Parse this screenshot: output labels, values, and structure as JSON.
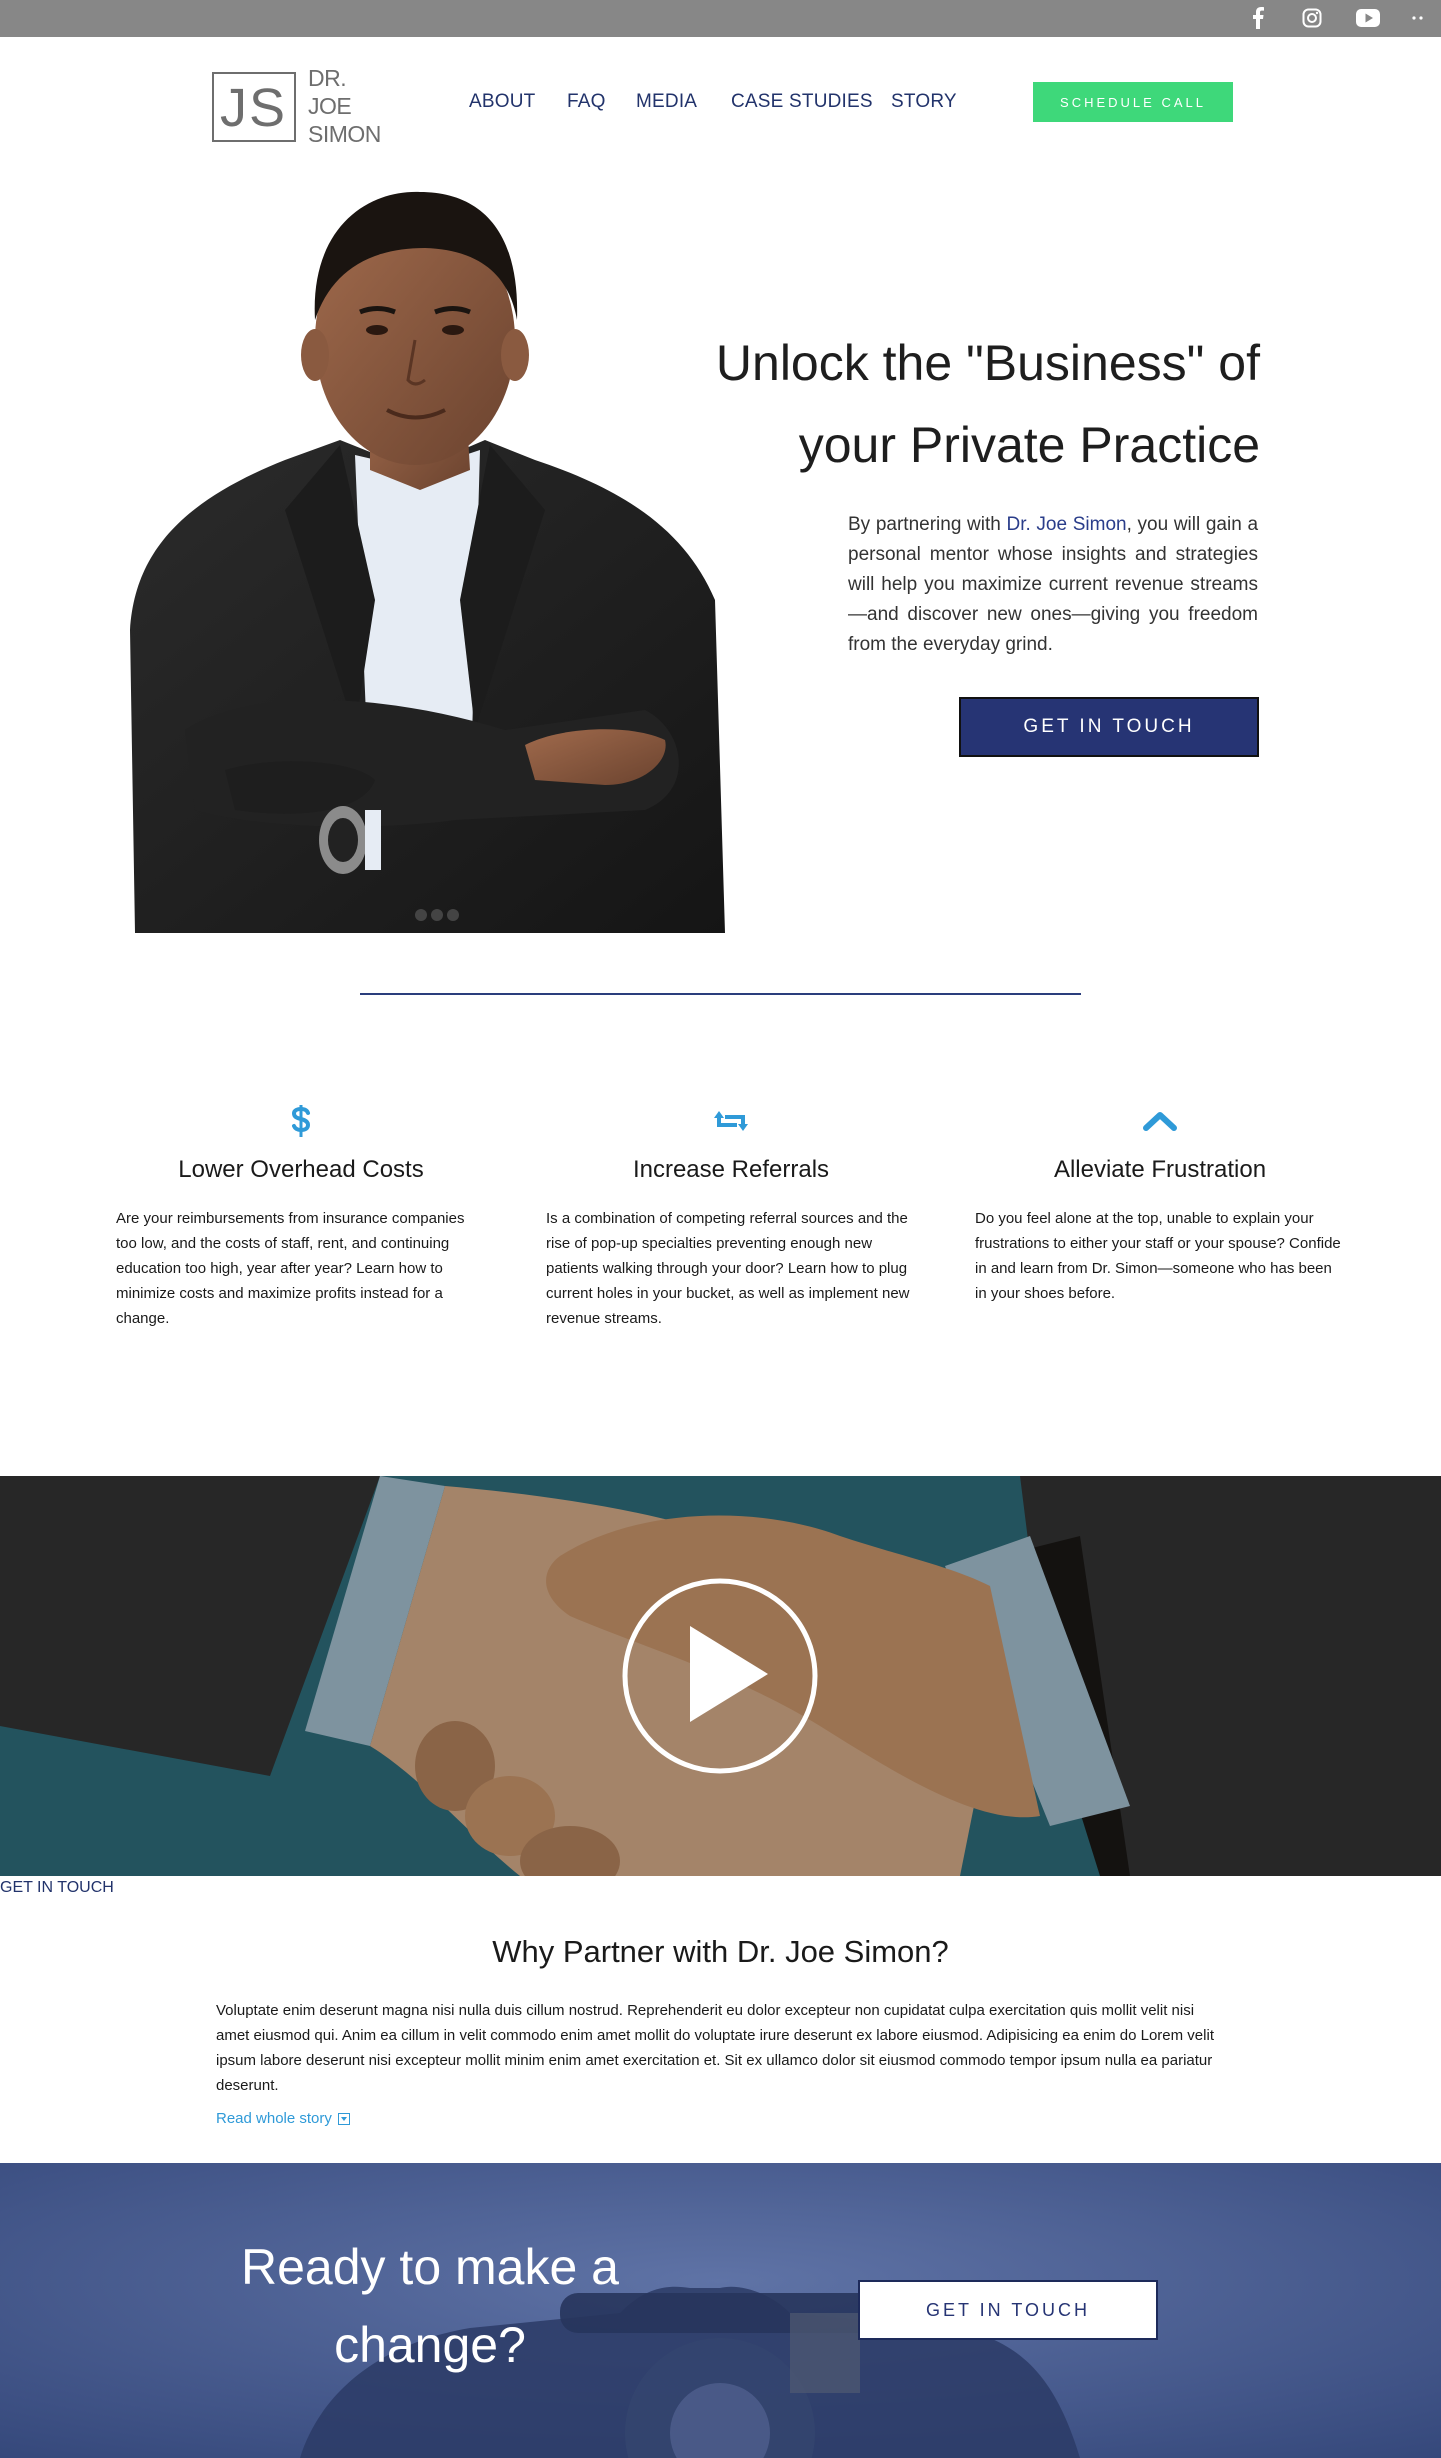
{
  "topbar": {
    "icons": [
      "facebook-icon",
      "instagram-icon",
      "youtube-icon",
      "more-icon"
    ],
    "color": "#878787"
  },
  "logo": {
    "monogram": "JS",
    "line1": "DR.",
    "line2": "JOE",
    "line3": "SIMON"
  },
  "nav": {
    "items": [
      {
        "label": "ABOUT"
      },
      {
        "label": "FAQ"
      },
      {
        "label": "MEDIA"
      },
      {
        "label": "CASE STUDIES"
      },
      {
        "label": "STORY"
      }
    ],
    "cta_label": "SCHEDULE CALL",
    "cta_color": "#3ed87a"
  },
  "hero": {
    "title_line1": "Unlock the \"Business\" of",
    "title_line2": "your Private Practice",
    "body_prefix": "By partnering with ",
    "body_link": "Dr. Joe Simon",
    "body_suffix": ", you will gain a personal mentor whose insights and strategies will help you maximize current revenue streams—and discover new ones—giving you freedom from the everyday grind.",
    "button_label": "GET IN TOUCH",
    "accent": "#263474"
  },
  "features": [
    {
      "icon": "dollar-icon",
      "title": "Lower Overhead Costs",
      "description": "Are your reimbursements from insurance companies too low, and the costs of staff, rent, and continuing education too high, year after year? Learn how to minimize costs and maximize profits instead for a change."
    },
    {
      "icon": "retweet-icon",
      "title": "Increase Referrals",
      "description": "Is a combination of competing referral sources and the rise of pop-up specialties preventing enough new patients walking through your door? Learn how to plug current holes in your bucket, as well as implement new revenue streams."
    },
    {
      "icon": "chevron-up-icon",
      "title": "Alleviate Frustration",
      "description": "Do you feel alone at the top, unable to explain your frustrations to either your staff or your spouse? Confide in and learn from Dr. Simon—someone who has been in your shoes before."
    }
  ],
  "video": {
    "link_label": "GET IN TOUCH"
  },
  "why": {
    "title": "Why Partner with Dr. Joe Simon?",
    "body": "Voluptate enim deserunt magna nisi nulla duis cillum nostrud. Reprehenderit eu dolor excepteur non cupidatat culpa exercitation quis mollit velit nisi amet eiusmod qui. Anim ea cillum in velit commodo enim amet mollit do voluptate irure deserunt ex labore eiusmod. Adipisicing ea enim do Lorem velit ipsum labore deserunt nisi excepteur mollit minim enim amet exercitation et. Sit ex ullamco dolor sit eiusmod commodo tempor ipsum nulla ea pariatur deserunt.",
    "read_more": "Read whole story"
  },
  "cta": {
    "title_line1": "Ready to make a",
    "title_line2": "change?",
    "button_label": "GET IN TOUCH"
  }
}
